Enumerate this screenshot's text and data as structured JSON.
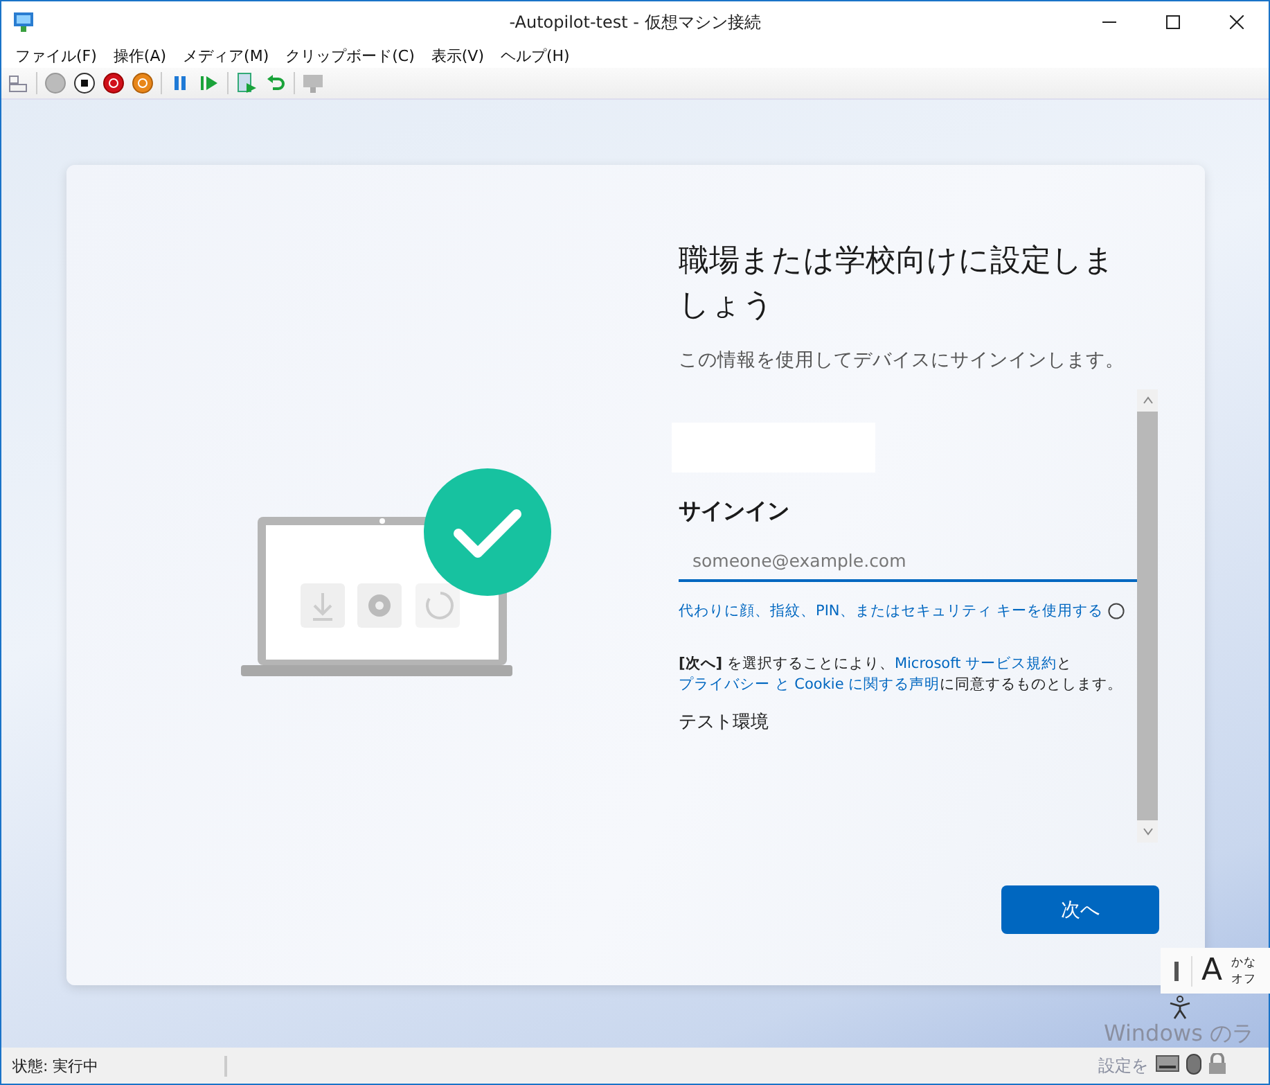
{
  "window": {
    "title": "-Autopilot-test - 仮想マシン接続"
  },
  "menu": [
    "ファイル(F)",
    "操作(A)",
    "メディア(M)",
    "クリップボード(C)",
    "表示(V)",
    "ヘルプ(H)"
  ],
  "oobe": {
    "heading": "職場または学校向けに設定しましょう",
    "subtitle": "この情報を使用してデバイスにサインインします。",
    "signin_title": "サインイン",
    "email": {
      "placeholder": "someone@example.com"
    },
    "alt_signin_link": "代わりに顔、指紋、PIN、またはセキュリティ キーを使用する",
    "terms": {
      "before": "**[次へ]** を選択することにより、",
      "link_1": "Microsoft サービス規約",
      "middle": "と",
      "link_2": "プライバシー と Cookie に関する声明",
      "after": "に同意するものとします。"
    },
    "note": "テスト環境",
    "next_button": "次へ"
  },
  "ime": {
    "mode": "A",
    "kana_lines": [
      "かな",
      "オフ"
    ]
  },
  "watermark": [
    "Windows のラ",
    "設定を"
  ],
  "status_bar": {
    "status": "状態: 実行中"
  }
}
